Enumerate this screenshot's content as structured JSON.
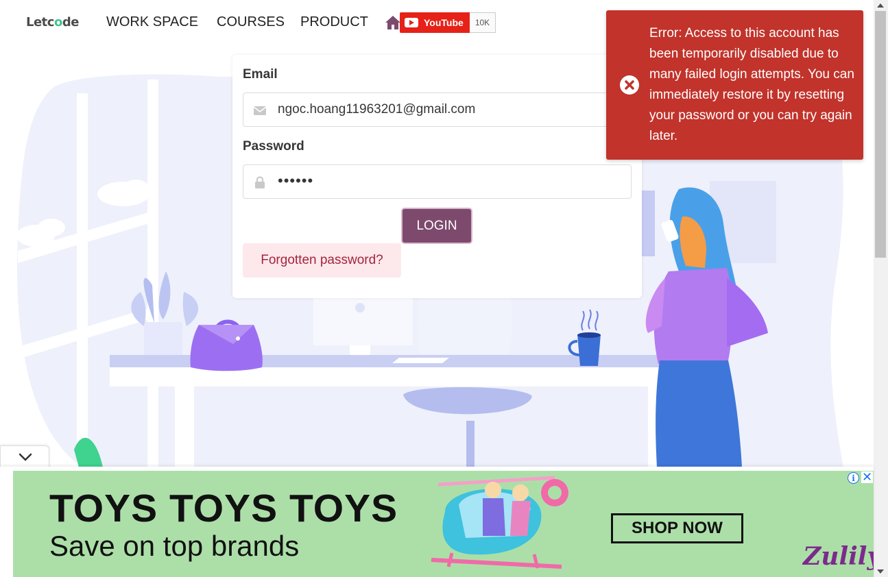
{
  "nav": {
    "logo_prefix": "Letc",
    "logo_o": "o",
    "logo_suffix": "de",
    "items": [
      {
        "label": "WORK SPACE"
      },
      {
        "label": "COURSES"
      },
      {
        "label": "PRODUCT"
      }
    ],
    "home_icon": "home-icon",
    "youtube": {
      "label": "YouTube",
      "count": "10K"
    }
  },
  "login": {
    "email_label": "Email",
    "email_value": "ngoc.hoang11963201@gmail.com",
    "password_label": "Password",
    "password_value": "••••••",
    "login_button": "LOGIN",
    "forgot_link": "Forgotten password?"
  },
  "toast": {
    "message": "Error: Access to this account has been temporarily disabled due to many failed login attempts. You can immediately restore it by resetting your password or you can try again later.",
    "color": "#c1332b"
  },
  "ad": {
    "headline": "TOYS TOYS TOYS",
    "subline": "Save on top brands",
    "cta": "SHOP NOW",
    "brand": "Zulily",
    "info_icon": "i",
    "close_icon": "✕",
    "background": "#acdfa8"
  },
  "colors": {
    "accent": "#7d4a6e",
    "logo_green": "#3ec58f",
    "error": "#c1332b"
  }
}
